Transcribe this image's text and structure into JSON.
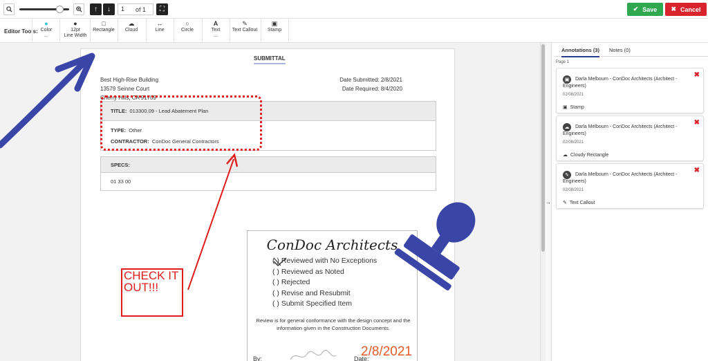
{
  "toolbar": {
    "zoom_out_icon": "zoom-out-icon",
    "zoom_in_icon": "zoom-in-icon",
    "zoom_level": 0.8,
    "page_current": "1",
    "page_of": "of 1",
    "save_label": "Save",
    "cancel_label": "Cancel",
    "colors": {
      "save": "#2fa84f",
      "cancel": "#d9232d"
    }
  },
  "editor_tools": {
    "label": "Editor Tools:",
    "tools": [
      {
        "label": "Color",
        "sub": "...",
        "icon": "●"
      },
      {
        "label": "12pt",
        "label2": "Line Width",
        "sub": "...",
        "icon": "●"
      },
      {
        "label": "Rectangle",
        "icon": "□"
      },
      {
        "label": "Cloud",
        "icon": "☁"
      },
      {
        "label": "Line",
        "icon": "↔"
      },
      {
        "label": "Circle",
        "icon": "○"
      },
      {
        "label": "Text",
        "sub": "...",
        "icon": "A"
      },
      {
        "label": "Text Callout",
        "icon": "✎"
      },
      {
        "label": "Stamp",
        "icon": "▣"
      }
    ]
  },
  "document": {
    "title": "SUBMITTAL",
    "address": [
      "Best High-Rise Building",
      "13579 Seinne Court",
      "Cherry Hills, CA 91709"
    ],
    "date_submitted_label": "Date Submitted:",
    "date_submitted": "2/8/2021",
    "date_required_label": "Date Required:",
    "date_required": "8/4/2020",
    "title_label": "TITLE:",
    "title_value": "013300.09 - Lead Abatement Plan",
    "type_label": "TYPE:",
    "type_value": "Other",
    "contractor_label": "CONTRACTOR:",
    "contractor_value": "ConDoc General Contractors",
    "specs_label": "SPECS:",
    "specs_value": "01 33 00"
  },
  "stamp": {
    "name": "ConDoc Architects",
    "options": [
      "Reviewed with No Exceptions",
      "Reviewed as Noted",
      "Rejected",
      "Revise and Resubmit",
      "Submit Specified Item"
    ],
    "option_prefix": "( )",
    "note": "Review is for general conformance with the design concept and the information given in the Construction Documents.",
    "by_label": "By:",
    "date_label": "Date:",
    "date_value": "2/8/2021"
  },
  "callout_text": "CHECK IT OUT!!!",
  "panel": {
    "tab_annotations": "Annotations (3)",
    "tab_notes": "Notes (0)",
    "page_label": "Page 1",
    "cards": [
      {
        "author": "Darla Melbourn - ConDoc Architects (Architect - Engineers)",
        "date": "02/08/2021",
        "kind": "Stamp",
        "icon": "stamp-icon"
      },
      {
        "author": "Darla Melbourn - ConDoc Architects (Architect - Engineers)",
        "date": "02/08/2021",
        "kind": "Cloudy Rectangle",
        "icon": "cloud-icon"
      },
      {
        "author": "Darla Melbourn - ConDoc Architects (Architect - Engineers)",
        "date": "02/08/2021",
        "kind": "Text Callout",
        "icon": "text-callout-icon"
      }
    ]
  }
}
